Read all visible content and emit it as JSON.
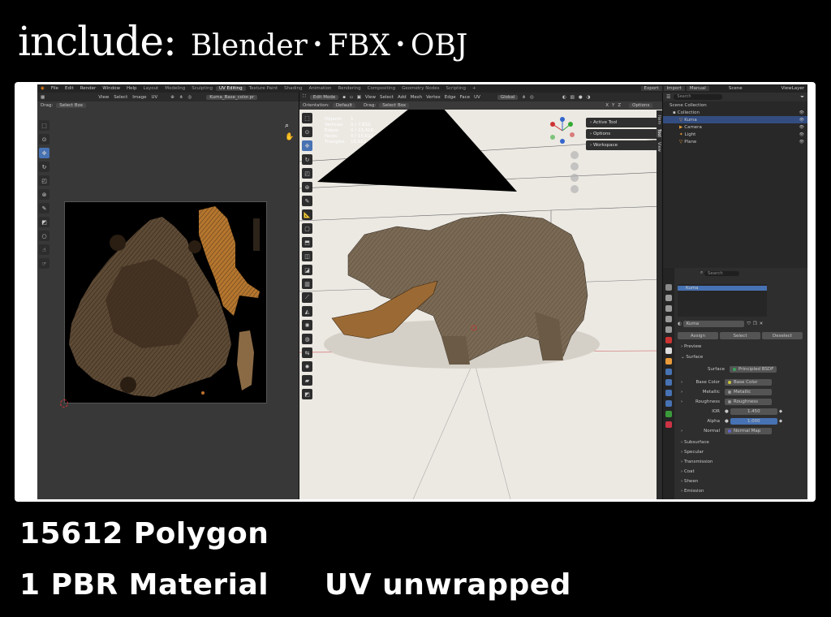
{
  "headline": {
    "prefix": "include:",
    "formats": [
      "Blender",
      "FBX",
      "OBJ"
    ],
    "separator": "•"
  },
  "captions": {
    "polygons": "15612 Polygon",
    "material": "1 PBR Material",
    "uv": "UV unwrapped"
  },
  "topbar": {
    "menus": [
      "File",
      "Edit",
      "Render",
      "Window",
      "Help"
    ],
    "workspaces": [
      "Layout",
      "Modeling",
      "Sculpting",
      "UV Editing",
      "Texture Paint",
      "Shading",
      "Animation",
      "Rendering",
      "Compositing",
      "Geometry Nodes",
      "Scripting",
      "+"
    ],
    "active_workspace": "UV Editing",
    "right": [
      "Export",
      "Import",
      "Manual",
      "Scene",
      "ViewLayer"
    ]
  },
  "uv_editor": {
    "menus": [
      "View",
      "Select",
      "Image",
      "UV"
    ],
    "image_name": "Kuma_Base_color.pr",
    "drag_label": "Drag:",
    "drag_value": "Select Box"
  },
  "viewport": {
    "mode": "Edit Mode",
    "menus": [
      "View",
      "Select",
      "Add",
      "Mesh",
      "Vertex",
      "Edge",
      "Face",
      "UV"
    ],
    "transform": "Global",
    "orientation_label": "Orientation:",
    "orientation_value": "Default",
    "drag_label": "Drag:",
    "drag_value": "Select Box",
    "axes": [
      "X",
      "Y",
      "Z"
    ],
    "options": "Options",
    "stats": [
      {
        "label": "Objects",
        "value": "1"
      },
      {
        "label": "Vertices",
        "value": "0 / 7,810"
      },
      {
        "label": "Edges",
        "value": "0 / 23,418"
      },
      {
        "label": "Faces",
        "value": "0 / 15,612"
      },
      {
        "label": "Triangles",
        "value": "15,612"
      }
    ],
    "npanel": [
      "Active Tool",
      "Options",
      "Workspace"
    ],
    "side_tabs": [
      "Item",
      "Tool",
      "View"
    ]
  },
  "outliner": {
    "search_placeholder": "Search",
    "items": [
      {
        "label": "Scene Collection",
        "indent": 0
      },
      {
        "label": "Collection",
        "indent": 1
      },
      {
        "label": "Kuma",
        "indent": 2,
        "selected": true
      },
      {
        "label": "Camera",
        "indent": 2
      },
      {
        "label": "Light",
        "indent": 2
      },
      {
        "label": "Plane",
        "indent": 2
      }
    ]
  },
  "properties": {
    "search_placeholder": "Search",
    "material_slot": "Kuma",
    "material_name": "Kuma",
    "buttons": [
      "Assign",
      "Select",
      "Deselect"
    ],
    "sections": [
      "Preview",
      "Surface"
    ],
    "surface_label": "Surface",
    "surface_value": "Principled BSDF",
    "fields": [
      {
        "label": "Base Color",
        "value": "Base Color",
        "dot": "#c7c23a"
      },
      {
        "label": "Metallic",
        "value": "Metallic",
        "dot": "#9a9a9a"
      },
      {
        "label": "Roughness",
        "value": "Roughness",
        "dot": "#9a9a9a"
      },
      {
        "label": "IOR",
        "value": "1.450"
      },
      {
        "label": "Alpha",
        "value": "1.000",
        "blue": true
      },
      {
        "label": "Normal",
        "value": "Normal Map",
        "dot": "#6363c7"
      }
    ],
    "collapsed": [
      "Subsurface",
      "Specular",
      "Transmission",
      "Coat",
      "Sheen",
      "Emission"
    ]
  }
}
